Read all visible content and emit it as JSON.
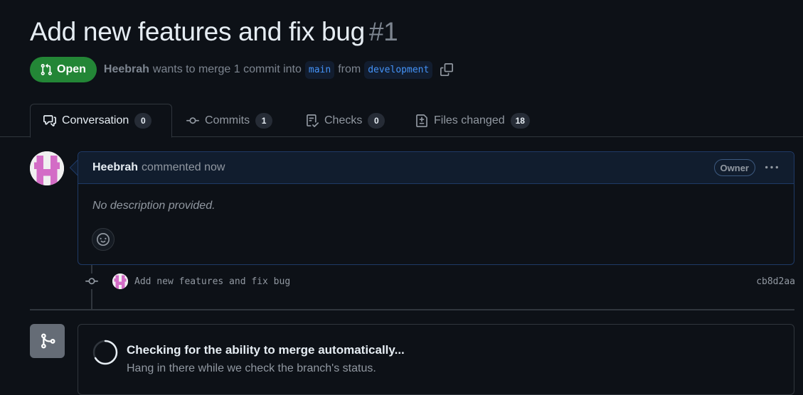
{
  "pr": {
    "title": "Add new features and fix bug",
    "number": "#1",
    "state": "Open",
    "author": "Heebrah",
    "merge_text": "wants to merge 1 commit into",
    "base_branch": "main",
    "from_text": "from",
    "head_branch": "development"
  },
  "tabs": [
    {
      "label": "Conversation",
      "count": "0",
      "icon": "comment-discussion-icon"
    },
    {
      "label": "Commits",
      "count": "1",
      "icon": "git-commit-icon"
    },
    {
      "label": "Checks",
      "count": "0",
      "icon": "checklist-icon"
    },
    {
      "label": "Files changed",
      "count": "18",
      "icon": "file-diff-icon"
    }
  ],
  "comment": {
    "author": "Heebrah",
    "action": "commented now",
    "role_badge": "Owner",
    "body": "No description provided."
  },
  "commit": {
    "message": "Add new features and fix bug",
    "sha": "cb8d2aa"
  },
  "merge_status": {
    "title": "Checking for the ability to merge automatically...",
    "subtitle": "Hang in there while we check the branch's status."
  },
  "colors": {
    "background": "#0d1117",
    "open_green": "#238636",
    "branch_blue": "#4493f8",
    "avatar_pink": "#d36cc6"
  }
}
